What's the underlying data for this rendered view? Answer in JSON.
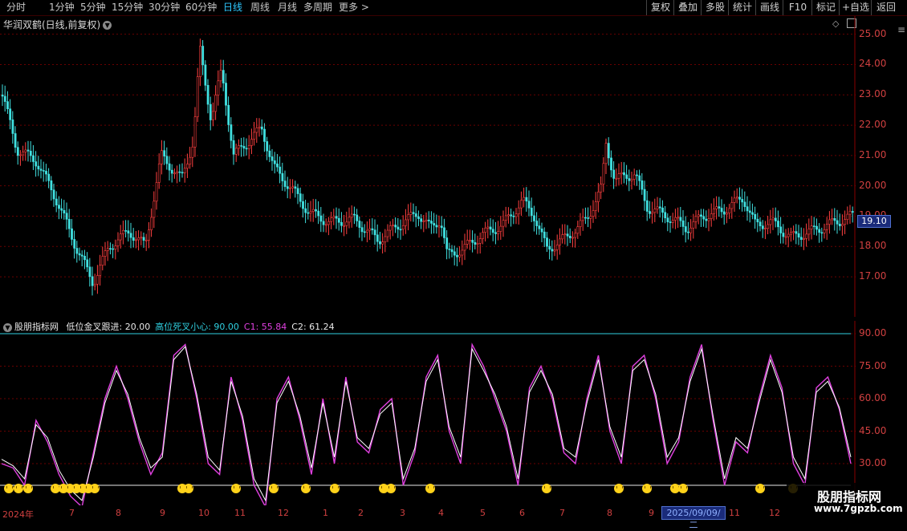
{
  "toolbar": {
    "periods": [
      "分时",
      "1分钟",
      "5分钟",
      "15分钟",
      "30分钟",
      "60分钟",
      "日线",
      "周线",
      "月线",
      "多周期",
      "更多 >"
    ],
    "active_period": "日线",
    "tools": [
      "复权",
      "叠加",
      "多股",
      "统计",
      "画线",
      "F10",
      "标记",
      "+自选",
      "返回"
    ]
  },
  "stock": {
    "title": "华润双鹤(日线,前复权)",
    "last_price": "19.10"
  },
  "price_axis": [
    "25.00",
    "24.00",
    "23.00",
    "22.00",
    "21.00",
    "20.00",
    "19.00",
    "18.00",
    "17.00"
  ],
  "indicator": {
    "name": "股朋指标网",
    "params": [
      {
        "label": "低位金叉跟进: 20.00",
        "color": "#e8e8e8"
      },
      {
        "label": "高位死叉小心: 90.00",
        "color": "#30d0e0"
      },
      {
        "label": "C1: 55.84",
        "color": "#e040e0"
      },
      {
        "label": "C2: 61.24",
        "color": "#e8e8e8"
      }
    ],
    "axis": [
      "90.00",
      "75.00",
      "60.00",
      "45.00",
      "30.00"
    ]
  },
  "x_labels": [
    "2024年",
    "7",
    "8",
    "9",
    "10",
    "11",
    "12",
    "1",
    "2",
    "3",
    "4",
    "5",
    "6",
    "7",
    "8",
    "9",
    "11",
    "12"
  ],
  "x_date_box": "2025/09/09/二",
  "watermark": {
    "title": "股朋指标网",
    "url": "www.7gpzb.com"
  },
  "colors": {
    "up": "#ff4040",
    "down": "#40e0e0",
    "grid": "#6a0000",
    "c1": "#e040e0",
    "c2": "#ffffff"
  },
  "chart_data": {
    "type": "line",
    "series": [
      {
        "name": "C1",
        "values": [
          30,
          28,
          20,
          50,
          40,
          25,
          15,
          10,
          35,
          60,
          75,
          60,
          40,
          25,
          35,
          80,
          85,
          60,
          30,
          25,
          70,
          50,
          20,
          10,
          60,
          70,
          50,
          25,
          60,
          30,
          70,
          40,
          35,
          55,
          60,
          20,
          35,
          70,
          80,
          45,
          30,
          85,
          75,
          60,
          45,
          20,
          65,
          75,
          60,
          35,
          30,
          60,
          80,
          45,
          30,
          75,
          80,
          60,
          30,
          40,
          70,
          85,
          50,
          20,
          40,
          35,
          60,
          80,
          65,
          30,
          20,
          65,
          70,
          55,
          30
        ]
      },
      {
        "name": "C2",
        "values": [
          32,
          29,
          23,
          48,
          42,
          27,
          18,
          13,
          33,
          58,
          73,
          62,
          42,
          28,
          33,
          78,
          84,
          62,
          33,
          27,
          68,
          52,
          23,
          13,
          58,
          68,
          52,
          28,
          58,
          33,
          68,
          42,
          37,
          53,
          58,
          23,
          37,
          68,
          78,
          47,
          33,
          83,
          73,
          62,
          47,
          23,
          63,
          73,
          62,
          37,
          33,
          58,
          78,
          47,
          33,
          73,
          78,
          62,
          33,
          42,
          68,
          83,
          52,
          23,
          42,
          37,
          58,
          78,
          63,
          33,
          23,
          63,
          68,
          56,
          33
        ]
      }
    ],
    "ylim": [
      20,
      95
    ]
  }
}
